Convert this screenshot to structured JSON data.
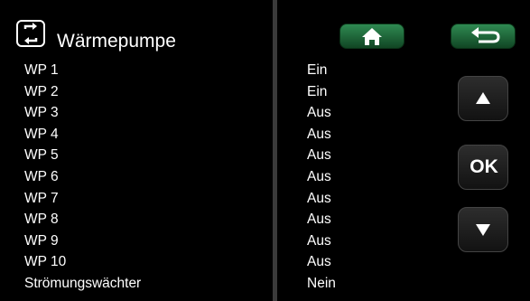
{
  "header": {
    "icon": "refresh-arrows-icon",
    "title": "Wärmepumpe"
  },
  "rows": [
    {
      "label": "WP 1",
      "value": "Ein"
    },
    {
      "label": "WP 2",
      "value": "Ein"
    },
    {
      "label": "WP 3",
      "value": "Aus"
    },
    {
      "label": "WP 4",
      "value": "Aus"
    },
    {
      "label": "WP 5",
      "value": "Aus"
    },
    {
      "label": "WP 6",
      "value": "Aus"
    },
    {
      "label": "WP 7",
      "value": "Aus"
    },
    {
      "label": "WP 8",
      "value": "Aus"
    },
    {
      "label": "WP 9",
      "value": "Aus"
    },
    {
      "label": "WP 10",
      "value": "Aus"
    },
    {
      "label": "Strömungswächter",
      "value": "Nein"
    }
  ],
  "buttons": {
    "home_icon": "home-icon",
    "back_icon": "back-arrow-icon",
    "up_icon": "up-arrow-icon",
    "ok_label": "OK",
    "down_icon": "down-arrow-icon"
  },
  "colors": {
    "background": "#000000",
    "text": "#ffffff",
    "nav_button_green": "#2f8a52",
    "side_button_dark": "#1e1e1e"
  }
}
